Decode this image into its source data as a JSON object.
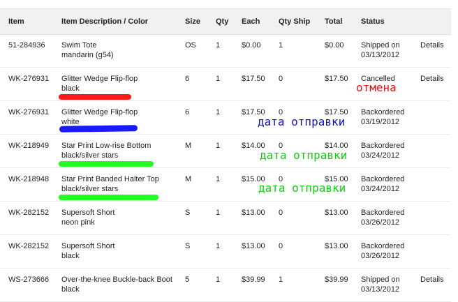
{
  "headers": {
    "item": "Item",
    "description": "Item Description / Color",
    "size": "Size",
    "qty": "Qty",
    "each": "Each",
    "qty_ship": "Qty Ship",
    "total": "Total",
    "status": "Status"
  },
  "rows": [
    {
      "item": "51-284936",
      "desc": "Swim Tote",
      "color": "mandarin (g54)",
      "size": "OS",
      "qty": "1",
      "each": "$0.00",
      "qty_ship": "1",
      "total": "$0.00",
      "status": "Shipped on",
      "status_date": "03/13/2012",
      "details": "Details"
    },
    {
      "item": "WK-276931",
      "desc": "Glitter Wedge Flip-flop",
      "color": "black",
      "size": "6",
      "qty": "1",
      "each": "$17.50",
      "qty_ship": "0",
      "total": "$17.50",
      "status": "Cancelled",
      "status_date": "",
      "details": "Details"
    },
    {
      "item": "WK-276931",
      "desc": "Glitter Wedge Flip-flop",
      "color": "white",
      "size": "6",
      "qty": "1",
      "each": "$17.50",
      "qty_ship": "0",
      "total": "$17.50",
      "status": "Backordered",
      "status_date": "03/19/2012",
      "details": ""
    },
    {
      "item": "WK-218949",
      "desc": "Star Print Low-rise Bottom",
      "color": "black/silver stars",
      "size": "M",
      "qty": "1",
      "each": "$14.00",
      "qty_ship": "0",
      "total": "$14.00",
      "status": "Backordered",
      "status_date": "03/24/2012",
      "details": ""
    },
    {
      "item": "WK-218948",
      "desc": "Star Print Banded Halter Top",
      "color": "black/silver stars",
      "size": "M",
      "qty": "1",
      "each": "$15.00",
      "qty_ship": "0",
      "total": "$15.00",
      "status": "Backordered",
      "status_date": "03/24/2012",
      "details": ""
    },
    {
      "item": "WK-282152",
      "desc": "Supersoft Short",
      "color": "neon pink",
      "size": "S",
      "qty": "1",
      "each": "$13.00",
      "qty_ship": "0",
      "total": "$13.00",
      "status": "Backordered",
      "status_date": "03/26/2012",
      "details": ""
    },
    {
      "item": "WK-282152",
      "desc": "Supersoft Short",
      "color": "black",
      "size": "S",
      "qty": "1",
      "each": "$13.00",
      "qty_ship": "0",
      "total": "$13.00",
      "status": "Backordered",
      "status_date": "03/26/2012",
      "details": ""
    },
    {
      "item": "WS-273666",
      "desc": "Over-the-knee Buckle-back Boot",
      "color": "black",
      "size": "5",
      "qty": "1",
      "each": "$39.99",
      "qty_ship": "1",
      "total": "$39.99",
      "status": "Shipped on",
      "status_date": "03/13/2012",
      "details": "Details"
    }
  ],
  "annotations": {
    "cancel": "отмена",
    "ship_date_1": "дата отправки",
    "ship_date_2": "дата отправки",
    "ship_date_3": "дата отправки"
  },
  "colors": {
    "red_mark": "#ff1a1a",
    "blue_mark": "#1a1aff",
    "green_mark": "#22ff22",
    "annot_red": "#ee1111",
    "annot_blue": "#1111cc",
    "annot_green": "#11cc11"
  }
}
